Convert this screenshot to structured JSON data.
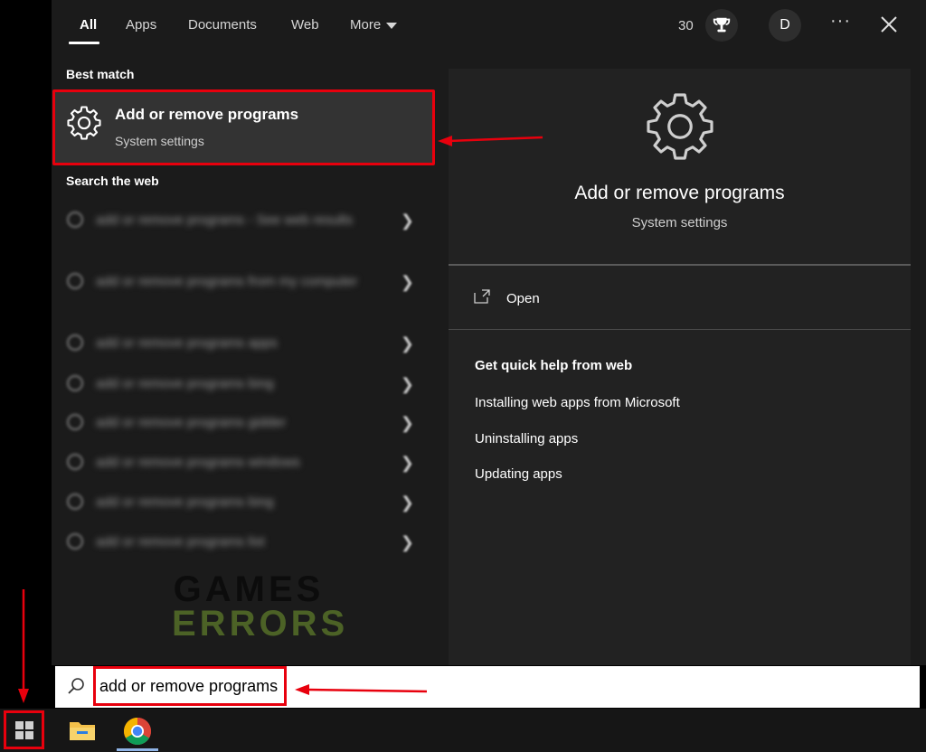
{
  "tabs": {
    "all": "All",
    "apps": "Apps",
    "documents": "Documents",
    "web": "Web",
    "more": "More"
  },
  "header": {
    "points": "30",
    "avatar_initial": "D",
    "more_options": "···"
  },
  "left": {
    "best_match_title": "Best match",
    "best_match": {
      "title": "Add or remove programs",
      "subtitle": "System settings"
    },
    "search_web_title": "Search the web",
    "web_results": [
      "add or remove programs - See web results",
      "add or remove programs from my computer",
      "add or remove programs apps",
      "add or remove programs bing",
      "add or remove programs gidder",
      "add or remove programs windows",
      "add or remove programs bing",
      "add or remove programs list"
    ]
  },
  "watermark": {
    "line1": "GAMES",
    "line2": "ERRORS"
  },
  "preview": {
    "title": "Add or remove programs",
    "subtitle": "System settings",
    "open_label": "Open",
    "quick_help_title": "Get quick help from web",
    "links": [
      "Installing web apps from Microsoft",
      "Uninstalling apps",
      "Updating apps"
    ]
  },
  "search": {
    "value": "add or remove programs"
  },
  "colors": {
    "highlight_red": "#e8000d",
    "panel_bg": "#1b1b1b",
    "preview_bg": "#222222",
    "card_bg": "#333333"
  },
  "icons": {
    "gear": "gear-icon",
    "search": "search-icon",
    "open": "open-window-icon",
    "trophy": "trophy-icon",
    "close": "close-icon",
    "windows": "windows-logo-icon",
    "explorer": "file-explorer-icon",
    "chrome": "chrome-icon"
  }
}
